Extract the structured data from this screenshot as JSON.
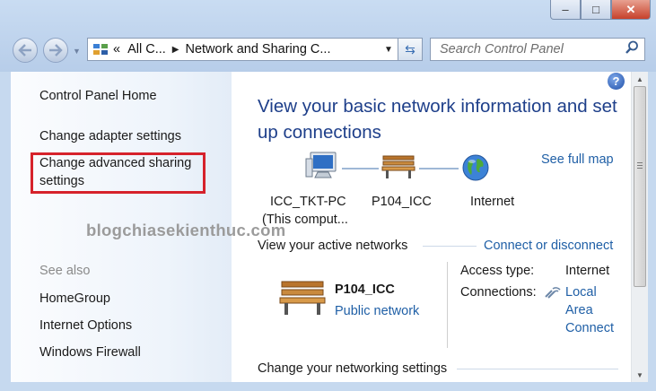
{
  "window": {
    "buttons": {
      "minimize": "–",
      "maximize": "□",
      "close": "✕"
    }
  },
  "nav": {
    "back_icon": "back-arrow-icon",
    "forward_icon": "forward-arrow-icon"
  },
  "address": {
    "prefix": "«",
    "crumbs": [
      "All C...",
      "Network and Sharing C..."
    ],
    "separator": "▶",
    "dropdown": "▼",
    "refresh": "⇆"
  },
  "search": {
    "placeholder": "Search Control Panel"
  },
  "sidebar": {
    "home": "Control Panel Home",
    "tasks": [
      "Change adapter settings",
      "Change advanced sharing",
      "settings"
    ],
    "see_also_label": "See also",
    "see_also": [
      "HomeGroup",
      "Internet Options",
      "Windows Firewall"
    ]
  },
  "watermark": "blogchiasekienthuc.com",
  "main": {
    "title_line1": "View your basic network information and set",
    "title_line2": "up connections",
    "see_full_map": "See full map",
    "map": {
      "computer_name": "ICC_TKT-PC",
      "computer_sub": "(This comput...",
      "network_name": "P104_ICC",
      "internet": "Internet"
    },
    "active_label": "View your active networks",
    "connect_link": "Connect or disconnect",
    "network": {
      "name": "P104_ICC",
      "type_link": "Public network",
      "access_label": "Access type:",
      "access_value": "Internet",
      "connections_label": "Connections:",
      "connections_lines": [
        "Local",
        "Area",
        "Connect"
      ]
    },
    "change_label": "Change your networking settings"
  },
  "colors": {
    "link": "#1f5fa6",
    "title": "#1e3f8a",
    "highlight": "#d6222b"
  }
}
